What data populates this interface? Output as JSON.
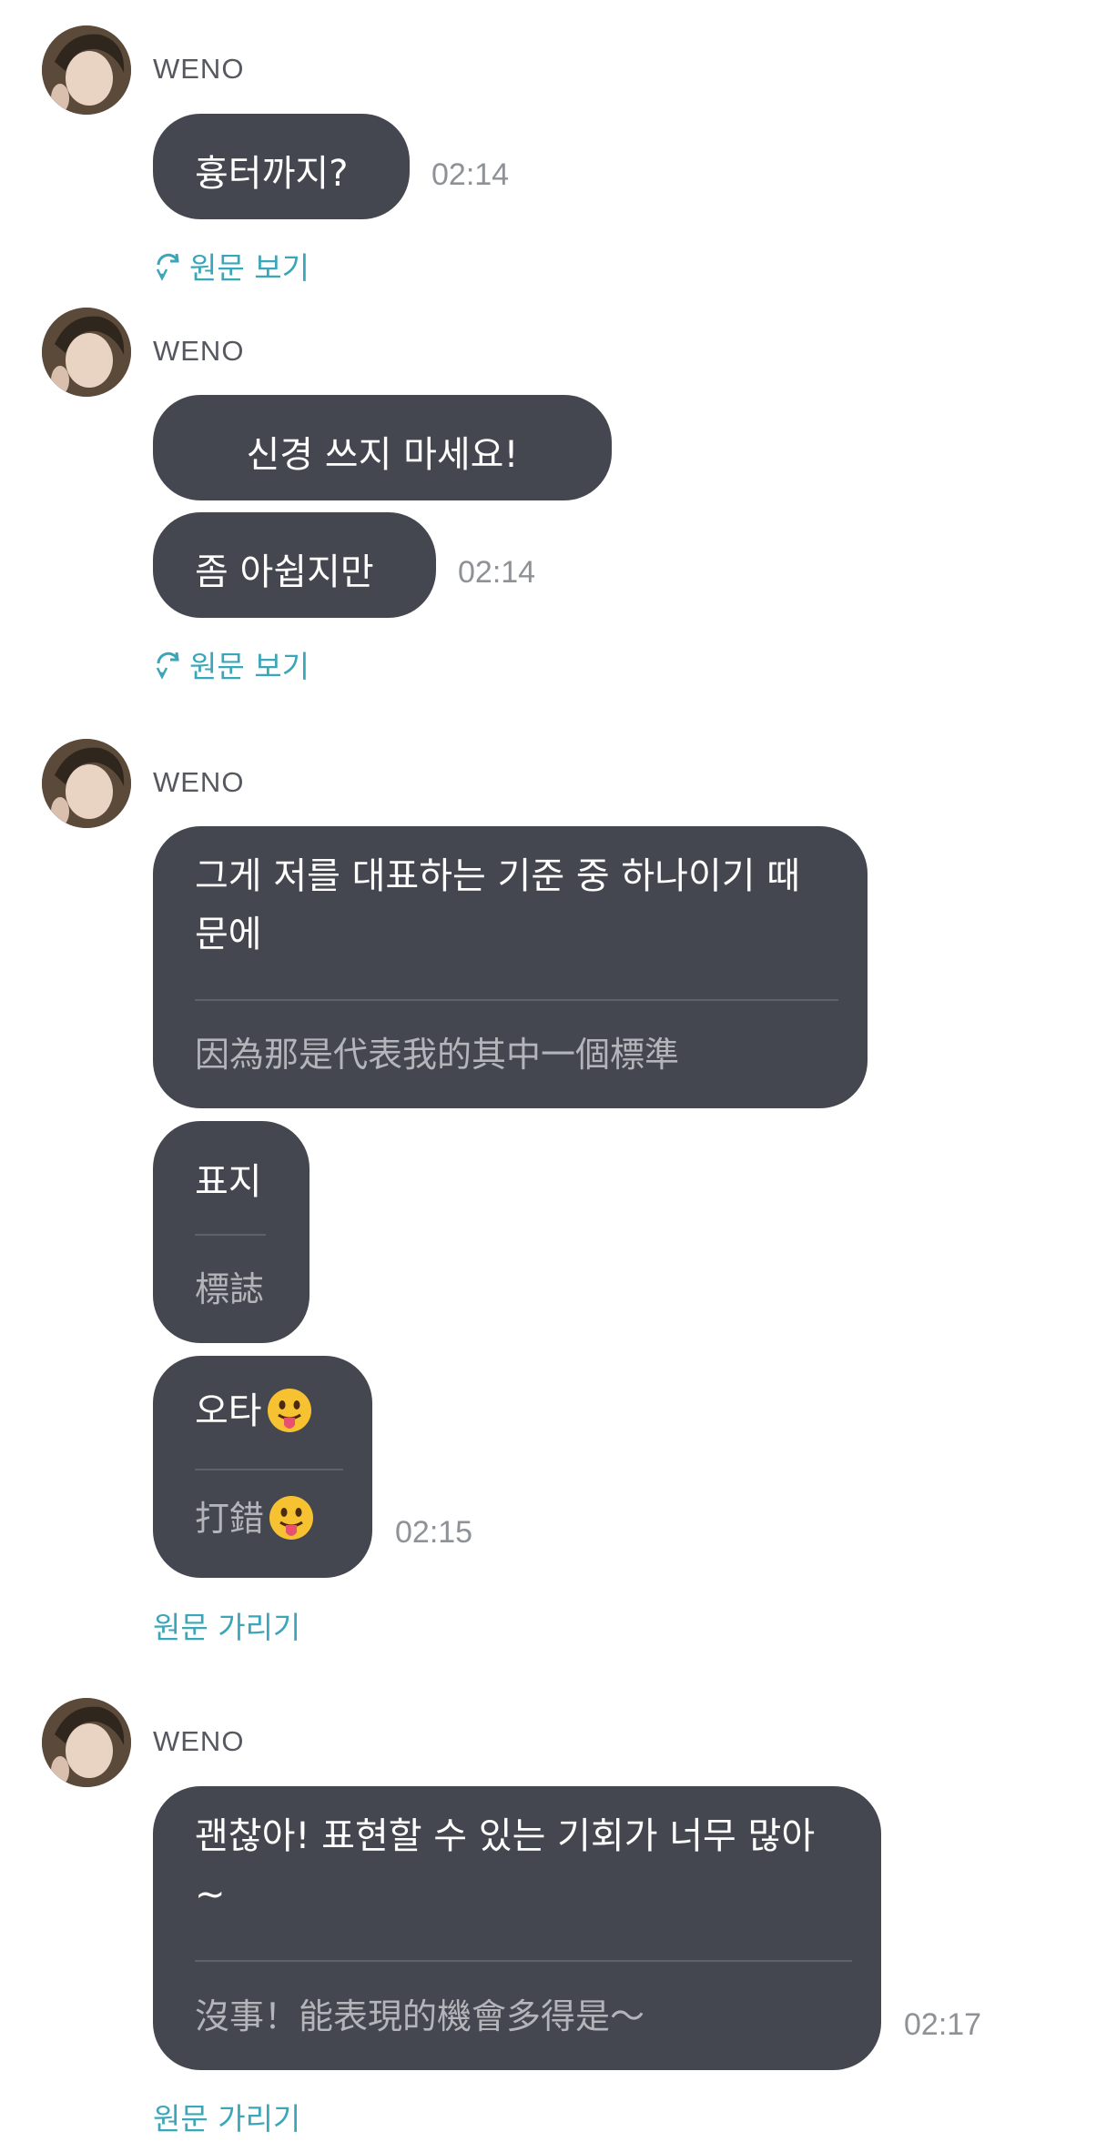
{
  "messages": [
    {
      "sender": "WENO",
      "bubbles": [
        {
          "text": "흉터까지?"
        }
      ],
      "time": "02:14",
      "toggle": {
        "label": "원문 보기",
        "icon": "translate-refresh-icon"
      }
    },
    {
      "sender": "WENO",
      "bubbles": [
        {
          "text": "신경 쓰지 마세요!"
        },
        {
          "text": "좀 아쉽지만"
        }
      ],
      "time": "02:14",
      "toggle": {
        "label": "원문 보기",
        "icon": "translate-refresh-icon"
      }
    },
    {
      "sender": "WENO",
      "bubbles": [
        {
          "text": "그게 저를 대표하는 기준 중 하나이기 때문에",
          "translation": "因為那是代表我的其中一個標準"
        },
        {
          "text": "표지",
          "translation": "標誌"
        },
        {
          "text": "오타",
          "translation": "打錯",
          "emoji": "tongue-out-emoji"
        }
      ],
      "time": "02:15",
      "toggle": {
        "label": "원문 가리기"
      }
    },
    {
      "sender": "WENO",
      "bubbles": [
        {
          "text": "괜찮아! 표현할 수 있는 기회가 너무 많아~",
          "translation": "沒事！能表現的機會多得是～"
        }
      ],
      "time": "02:17",
      "toggle": {
        "label": "원문 가리기"
      }
    }
  ],
  "colors": {
    "bubble": "#44474f",
    "bubble_text": "#ffffff",
    "translation_text": "#b3b5ba",
    "link": "#3aa6b8",
    "timestamp": "#8e9196"
  }
}
